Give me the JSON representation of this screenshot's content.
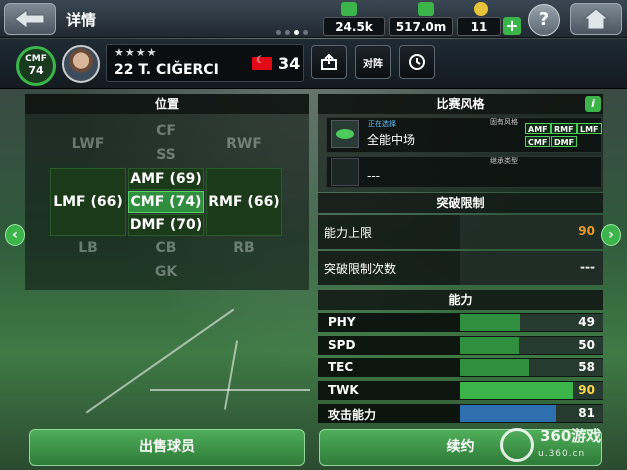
{
  "header": {
    "title": "详情",
    "resources": [
      {
        "name": "gp",
        "value": "24.5k",
        "color": "#3bb54a"
      },
      {
        "name": "money",
        "value": "517.0m",
        "color": "#3bb54a"
      },
      {
        "name": "coins",
        "value": "11",
        "color": "#e8c43a"
      }
    ],
    "page_dots": 4,
    "active_dot": 2
  },
  "player": {
    "position": "CMF",
    "rating": "74",
    "stars": "★★★★",
    "name": "22 T. CIĞERCI",
    "age": "34",
    "btn_formation": "对阵"
  },
  "positions": {
    "title": "位置",
    "inactive": [
      "CF",
      "LWF",
      "RWF",
      "SS",
      "LB",
      "CB",
      "RB",
      "GK"
    ],
    "active": {
      "lmf": "LMF (66)",
      "amf": "AMF (69)",
      "cmf": "CMF (74)",
      "rmf": "RMF (66)",
      "dmf": "DMF (70)"
    }
  },
  "style": {
    "title": "比赛风格",
    "current_label": "正在选择",
    "current_value": "全能中场",
    "inherent_label": "固有风格",
    "chips": [
      "AMF",
      "RMF",
      "LMF",
      "CMF",
      "DMF"
    ],
    "inherit_label": "继承类型",
    "inherit_value": "---"
  },
  "limits": {
    "title": "突破限制",
    "rows": [
      {
        "label": "能力上限",
        "value": "90",
        "color": "#e89a2a"
      },
      {
        "label": "突破限制次数",
        "value": "---",
        "color": "#ffffff"
      }
    ]
  },
  "abilities": {
    "title": "能力",
    "rows": [
      {
        "label": "PHY",
        "value": "49",
        "fill": 0.42,
        "color": "#2f8f3f",
        "num_color": "#ffffff"
      },
      {
        "label": "SPD",
        "value": "50",
        "fill": 0.41,
        "color": "#2f8f3f",
        "num_color": "#ffffff"
      },
      {
        "label": "TEC",
        "value": "58",
        "fill": 0.48,
        "color": "#2f8f3f",
        "num_color": "#ffffff"
      },
      {
        "label": "TWK",
        "value": "90",
        "fill": 0.79,
        "color": "#3bb54a",
        "num_color": "#ffd84a"
      },
      {
        "label": "攻击能力",
        "value": "81",
        "fill": 0.67,
        "color": "#2e6fb0",
        "num_color": "#ffffff"
      }
    ]
  },
  "bottom": {
    "sell": "出售球员",
    "renew": "续约"
  },
  "watermark": {
    "brand": "360游戏",
    "url": "u.360.cn"
  }
}
